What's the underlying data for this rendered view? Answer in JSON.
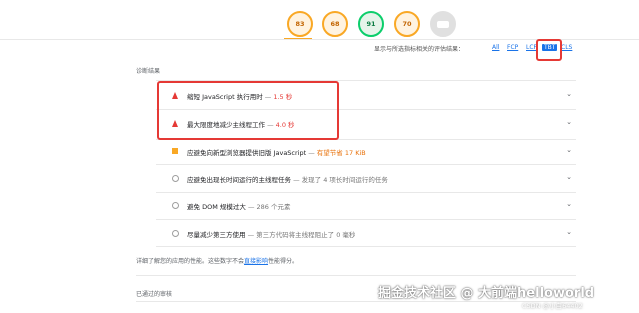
{
  "scores": [
    {
      "value": "83",
      "color": "#f9a825"
    },
    {
      "value": "68",
      "color": "#f9a825"
    },
    {
      "value": "91",
      "color": "#0cce6b"
    },
    {
      "value": "70",
      "color": "#f9a825"
    },
    {
      "value": "",
      "color": "#e0e0e0"
    }
  ],
  "filter": {
    "label": "显示与所选指标相关的评估结果：",
    "chips": [
      "All",
      "FCP",
      "LCP",
      "TBT",
      "CLS"
    ],
    "active": "TBT"
  },
  "diagnostics": {
    "title": "诊断结果",
    "rows": [
      {
        "title": "缩短 JavaScript 执行用时",
        "sep": " — ",
        "value": "1.5 秒",
        "marker": "triangle",
        "value_color": "red"
      },
      {
        "title": "最大限度地减少主线程工作",
        "sep": " — ",
        "value": "4.0 秒",
        "marker": "triangle",
        "value_color": "red"
      },
      {
        "title": "应避免向新型浏览器提供旧版 JavaScript",
        "sep": " — ",
        "value": "有望节省 17 KiB",
        "marker": "square",
        "value_color": "orange"
      },
      {
        "title": "应避免出现长时间运行的主线程任务",
        "sep": " — ",
        "value": "发现了 4 项长时间运行的任务",
        "marker": "circle",
        "value_color": "gray"
      },
      {
        "title": "避免 DOM 规模过大",
        "sep": " — ",
        "value": "286 个元素",
        "marker": "circle",
        "value_color": "gray"
      },
      {
        "title": "尽量减少第三方使用",
        "sep": " — ",
        "value": "第三方代码将主线程阻止了 0 毫秒",
        "marker": "circle",
        "value_color": "gray"
      }
    ]
  },
  "footnote": {
    "before": "详细了解您的应用的性能。这些数字不会",
    "link": "直接影响",
    "after": "性能得分。"
  },
  "passed": "已通过的审核",
  "watermark": "掘金技术社区 @ 大前端helloworld",
  "watermark_small": "CSDN @小白64402"
}
